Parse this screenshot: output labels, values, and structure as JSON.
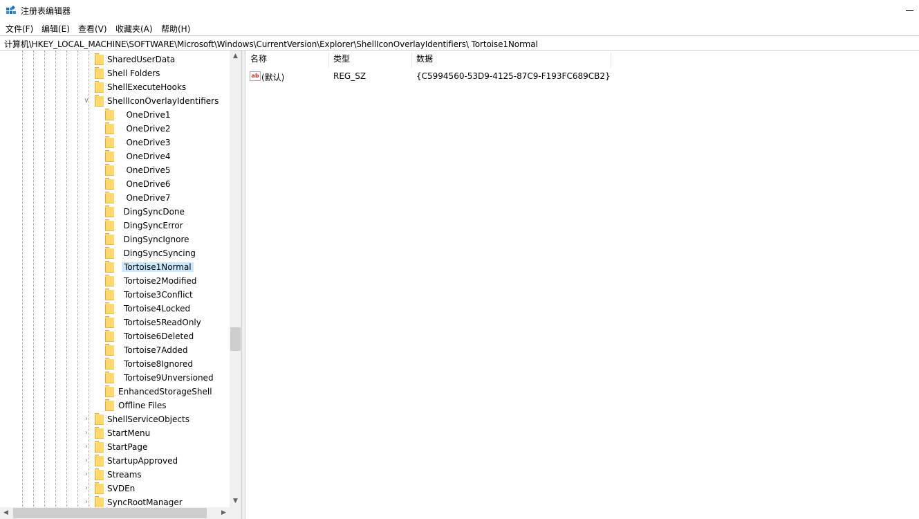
{
  "window": {
    "title": "注册表编辑器",
    "icons": {
      "app": "regedit-icon",
      "minimize": "minimize-icon"
    }
  },
  "menu": [
    "文件(F)",
    "编辑(E)",
    "查看(V)",
    "收藏夹(A)",
    "帮助(H)"
  ],
  "address": "计算机\\HKEY_LOCAL_MACHINE\\SOFTWARE\\Microsoft\\Windows\\CurrentVersion\\Explorer\\ShellIconOverlayIdentifiers\\  Tortoise1Normal",
  "tree": {
    "selected": "Tortoise1Normal",
    "items": [
      {
        "label": "SharedUserData",
        "expander": ""
      },
      {
        "label": "Shell Folders",
        "expander": ""
      },
      {
        "label": "ShellExecuteHooks",
        "expander": ""
      },
      {
        "label": "ShellIconOverlayIdentifiers",
        "expander": "expanded"
      },
      {
        "label": "   OneDrive1",
        "expander": ""
      },
      {
        "label": "   OneDrive2",
        "expander": ""
      },
      {
        "label": "   OneDrive3",
        "expander": ""
      },
      {
        "label": "   OneDrive4",
        "expander": ""
      },
      {
        "label": "   OneDrive5",
        "expander": ""
      },
      {
        "label": "   OneDrive6",
        "expander": ""
      },
      {
        "label": "   OneDrive7",
        "expander": ""
      },
      {
        "label": "  DingSyncDone",
        "expander": ""
      },
      {
        "label": "  DingSyncError",
        "expander": ""
      },
      {
        "label": "  DingSyncIgnore",
        "expander": ""
      },
      {
        "label": "  DingSyncSyncing",
        "expander": ""
      },
      {
        "label": "Tortoise1Normal",
        "expander": ""
      },
      {
        "label": "Tortoise2Modified",
        "expander": ""
      },
      {
        "label": "Tortoise3Conflict",
        "expander": ""
      },
      {
        "label": "Tortoise4Locked",
        "expander": ""
      },
      {
        "label": "Tortoise5ReadOnly",
        "expander": ""
      },
      {
        "label": "Tortoise6Deleted",
        "expander": ""
      },
      {
        "label": "Tortoise7Added",
        "expander": ""
      },
      {
        "label": "Tortoise8Ignored",
        "expander": ""
      },
      {
        "label": "Tortoise9Unversioned",
        "expander": ""
      },
      {
        "label": "EnhancedStorageShell",
        "expander": ""
      },
      {
        "label": "Offline Files",
        "expander": ""
      },
      {
        "label": "ShellServiceObjects",
        "expander": "collapsed"
      },
      {
        "label": "StartMenu",
        "expander": "collapsed"
      },
      {
        "label": "StartPage",
        "expander": "collapsed"
      },
      {
        "label": "StartupApproved",
        "expander": "collapsed"
      },
      {
        "label": "Streams",
        "expander": "collapsed"
      },
      {
        "label": "SVDEn",
        "expander": "collapsed"
      },
      {
        "label": "SyncRootManager",
        "expander": "collapsed"
      }
    ]
  },
  "list": {
    "columns": [
      "名称",
      "类型",
      "数据"
    ],
    "rows": [
      {
        "name": "(默认)",
        "type": "REG_SZ",
        "data": "{C5994560-53D9-4125-87C9-F193FC689CB2}",
        "icon": "string-value-icon"
      }
    ]
  }
}
